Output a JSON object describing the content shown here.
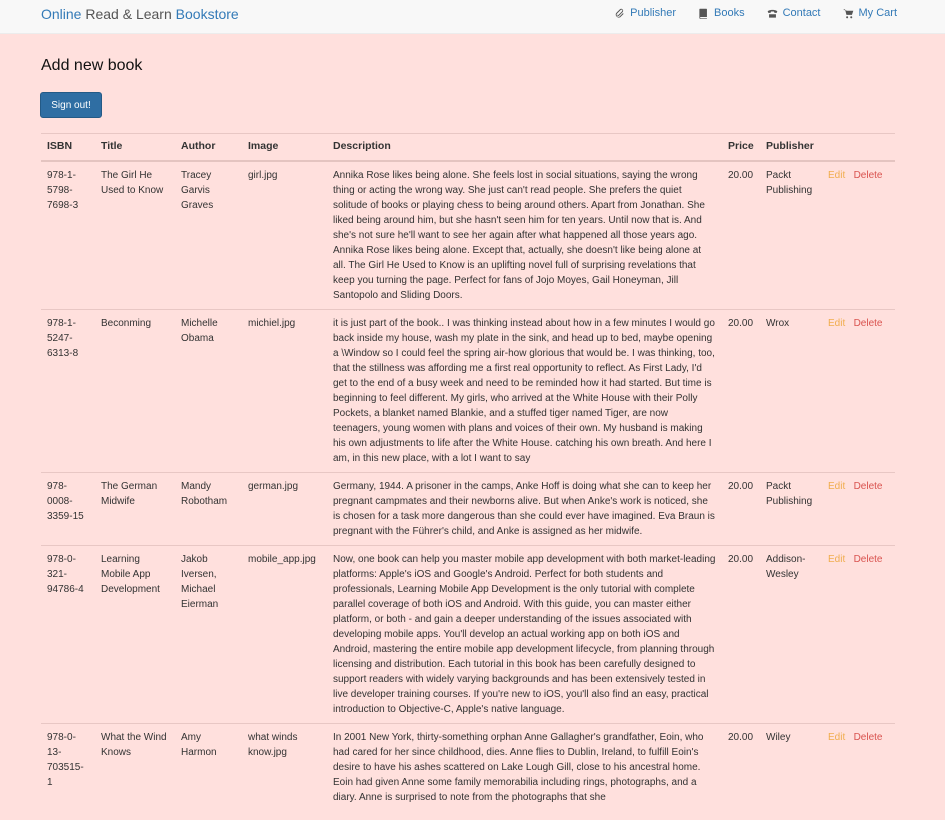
{
  "navbar": {
    "brand_online": "Online",
    "brand_mid": "Read & Learn",
    "brand_bookstore": "Bookstore",
    "items": [
      {
        "label": "Publisher",
        "icon": "paperclip-icon"
      },
      {
        "label": "Books",
        "icon": "book-icon"
      },
      {
        "label": "Contact",
        "icon": "phone-icon"
      },
      {
        "label": "My Cart",
        "icon": "shopping-cart-icon"
      }
    ]
  },
  "page": {
    "title": "Add new book",
    "signout_label": "Sign out!"
  },
  "table": {
    "headers": [
      "ISBN",
      "Title",
      "Author",
      "Image",
      "Description",
      "Price",
      "Publisher",
      ""
    ],
    "edit_label": "Edit",
    "delete_label": "Delete",
    "rows": [
      {
        "isbn": "978-1-5798-7698-3",
        "title": "The Girl He Used to Know",
        "author": "Tracey Garvis Graves",
        "image": "girl.jpg",
        "description": "Annika Rose likes being alone. She feels lost in social situations, saying the wrong thing or acting the wrong way. She just can't read people. She prefers the quiet solitude of books or playing chess to being around others. Apart from Jonathan. She liked being around him, but she hasn't seen him for ten years. Until now that is. And she's not sure he'll want to see her again after what happened all those years ago. Annika Rose likes being alone. Except that, actually, she doesn't like being alone at all. The Girl He Used to Know is an uplifting novel full of surprising revelations that keep you turning the page. Perfect for fans of Jojo Moyes, Gail Honeyman, Jill Santopolo and Sliding Doors.",
        "price": "20.00",
        "publisher": "Packt Publishing"
      },
      {
        "isbn": "978-1-5247-6313-8",
        "title": "Beconming",
        "author": "Michelle Obama",
        "image": "michiel.jpg",
        "description": "it is just part of the book.. I was thinking instead about how in a few minutes I would go back inside my house, wash my plate in the sink, and head up to bed, maybe opening a \\Window so I could feel the spring air-how glorious that would be. I was thinking, too, that the stillness was affording me a first real opportunity to reflect. As First Lady, I'd get to the end of a busy week and need to be reminded how it had started. But time is beginning to feel different. My girls, who arrived at the White House with their Polly Pockets, a blanket named Blankie, and a stuffed tiger named Tiger, are now teenagers, young women with plans and voices of their own. My husband is making his own adjustments to life after the White House. catching his own breath. And here I am, in this new place, with a lot I want to say",
        "price": "20.00",
        "publisher": "Wrox"
      },
      {
        "isbn": "978-0008-3359-15",
        "title": "The German Midwife",
        "author": "Mandy Robotham",
        "image": "german.jpg",
        "description": "Germany, 1944. A prisoner in the camps, Anke Hoff is doing what she can to keep her pregnant campmates and their newborns alive. But when Anke's work is noticed, she is chosen for a task more dangerous than she could ever have imagined. Eva Braun is pregnant with the Führer's child, and Anke is assigned as her midwife.",
        "price": "20.00",
        "publisher": "Packt Publishing"
      },
      {
        "isbn": "978-0-321-94786-4",
        "title": "Learning Mobile App Development",
        "author": "Jakob Iversen, Michael Eierman",
        "image": "mobile_app.jpg",
        "description": "Now, one book can help you master mobile app development with both market-leading platforms: Apple's iOS and Google's Android. Perfect for both students and professionals, Learning Mobile App Development is the only tutorial with complete parallel coverage of both iOS and Android. With this guide, you can master either platform, or both - and gain a deeper understanding of the issues associated with developing mobile apps. You'll develop an actual working app on both iOS and Android, mastering the entire mobile app development lifecycle, from planning through licensing and distribution. Each tutorial in this book has been carefully designed to support readers with widely varying backgrounds and has been extensively tested in live developer training courses. If you're new to iOS, you'll also find an easy, practical introduction to Objective-C, Apple's native language.",
        "price": "20.00",
        "publisher": "Addison-Wesley"
      },
      {
        "isbn": "978-0-13-703515-1",
        "title": "What the Wind Knows",
        "author": "Amy Harmon",
        "image": "what winds know.jpg",
        "description": "In 2001 New York, thirty-something orphan Anne Gallagher's grandfather, Eoin, who had cared for her since childhood, dies. Anne flies to Dublin, Ireland, to fulfill Eoin's desire to have his ashes scattered on Lake Lough Gill, close to his ancestral home. Eoin had given Anne some family memorabilia including rings, photographs, and a diary. Anne is surprised to note from the photographs that she",
        "price": "20.00",
        "publisher": "Wiley"
      }
    ]
  }
}
